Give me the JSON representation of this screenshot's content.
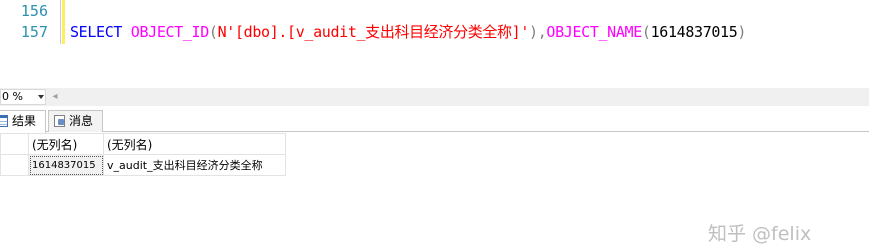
{
  "editor": {
    "lines": [
      {
        "number": "156",
        "code": ""
      },
      {
        "number": "157",
        "tokens": {
          "select": "SELECT",
          "sp1": " ",
          "fn1": "OBJECT_ID",
          "p1": "(",
          "str": "N'[dbo].[v_audit_支出科目经济分类全称]'",
          "p2": ")",
          "comma": ",",
          "fn2": "OBJECT_NAME",
          "p3": "(",
          "num": "1614837015",
          "p4": ")"
        }
      }
    ]
  },
  "zoombar": {
    "zoom": "0 %"
  },
  "results": {
    "tabs": [
      {
        "label": "结果",
        "icon": "results-grid-icon"
      },
      {
        "label": "消息",
        "icon": "messages-icon"
      }
    ],
    "columns": [
      "(无列名)",
      "(无列名)"
    ],
    "rows": [
      [
        "1614837015",
        "v_audit_支出科目经济分类全称"
      ]
    ]
  },
  "watermark": "知乎 @felix",
  "colors": {
    "keyword": "#0000ff",
    "function": "#ff00ff",
    "string": "#ff0000",
    "punctuation": "#808080",
    "line_number": "#2b91af"
  }
}
